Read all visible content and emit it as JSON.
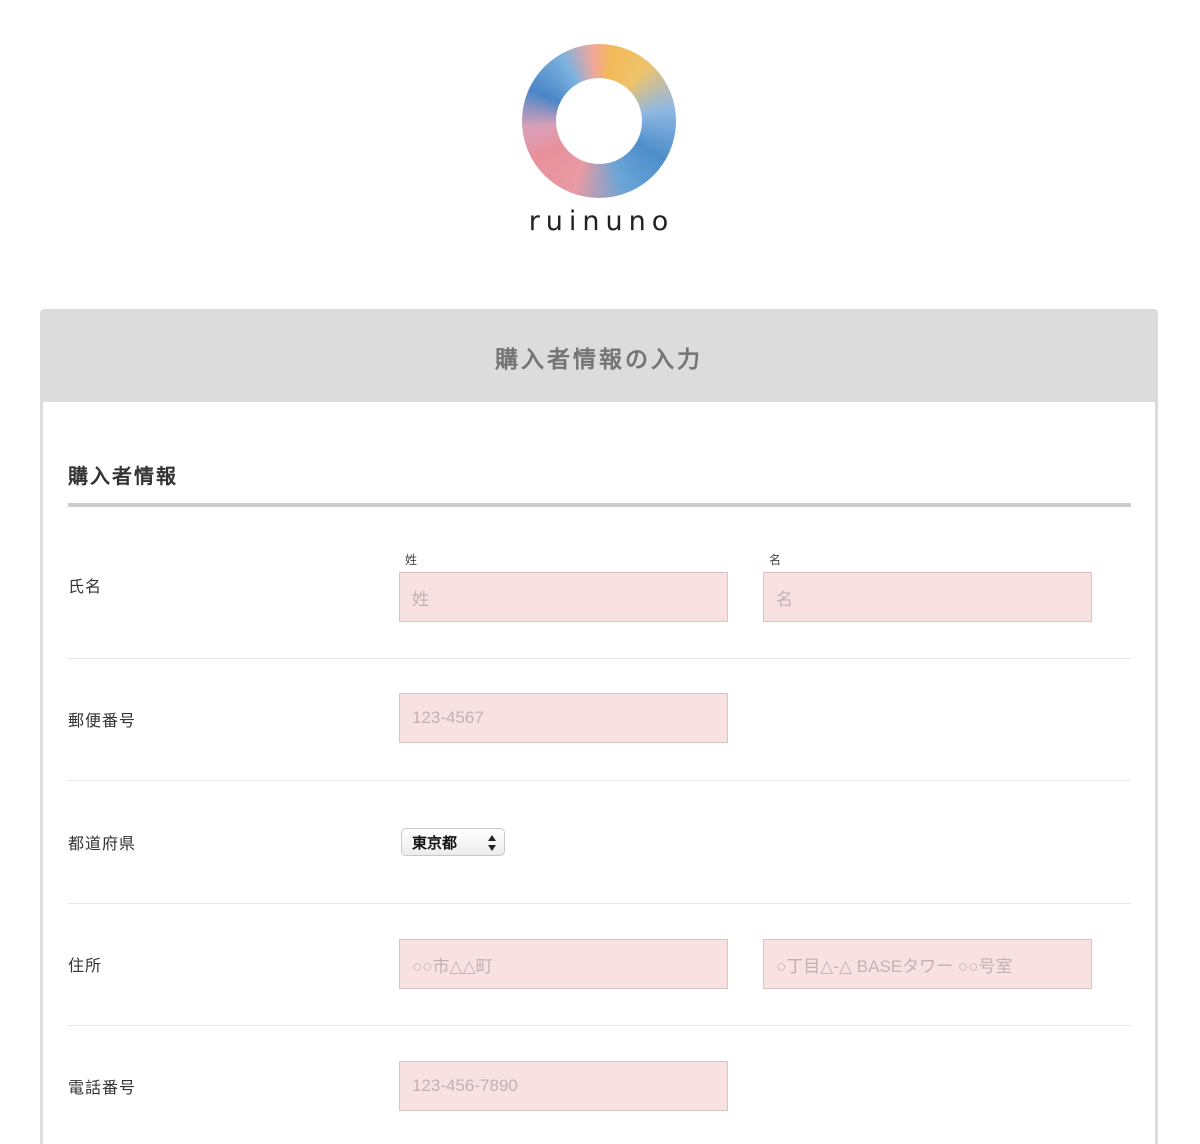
{
  "logo": {
    "text": "ruinuno"
  },
  "card": {
    "header_title": "購入者情報の入力",
    "section_title": "購入者情報"
  },
  "form": {
    "name": {
      "label": "氏名",
      "last_label": "姓",
      "last_placeholder": "姓",
      "first_label": "名",
      "first_placeholder": "名"
    },
    "postal": {
      "label": "郵便番号",
      "placeholder": "123-4567"
    },
    "prefecture": {
      "label": "都道府県",
      "selected": "東京都"
    },
    "address": {
      "label": "住所",
      "placeholder1": "○○市△△町",
      "placeholder2": "○丁目△-△ BASEタワー ○○号室"
    },
    "phone": {
      "label": "電話番号",
      "placeholder": "123-456-7890"
    }
  },
  "colors": {
    "field_bg": "#f7e1e1",
    "header_bg": "#dcdcdc"
  }
}
